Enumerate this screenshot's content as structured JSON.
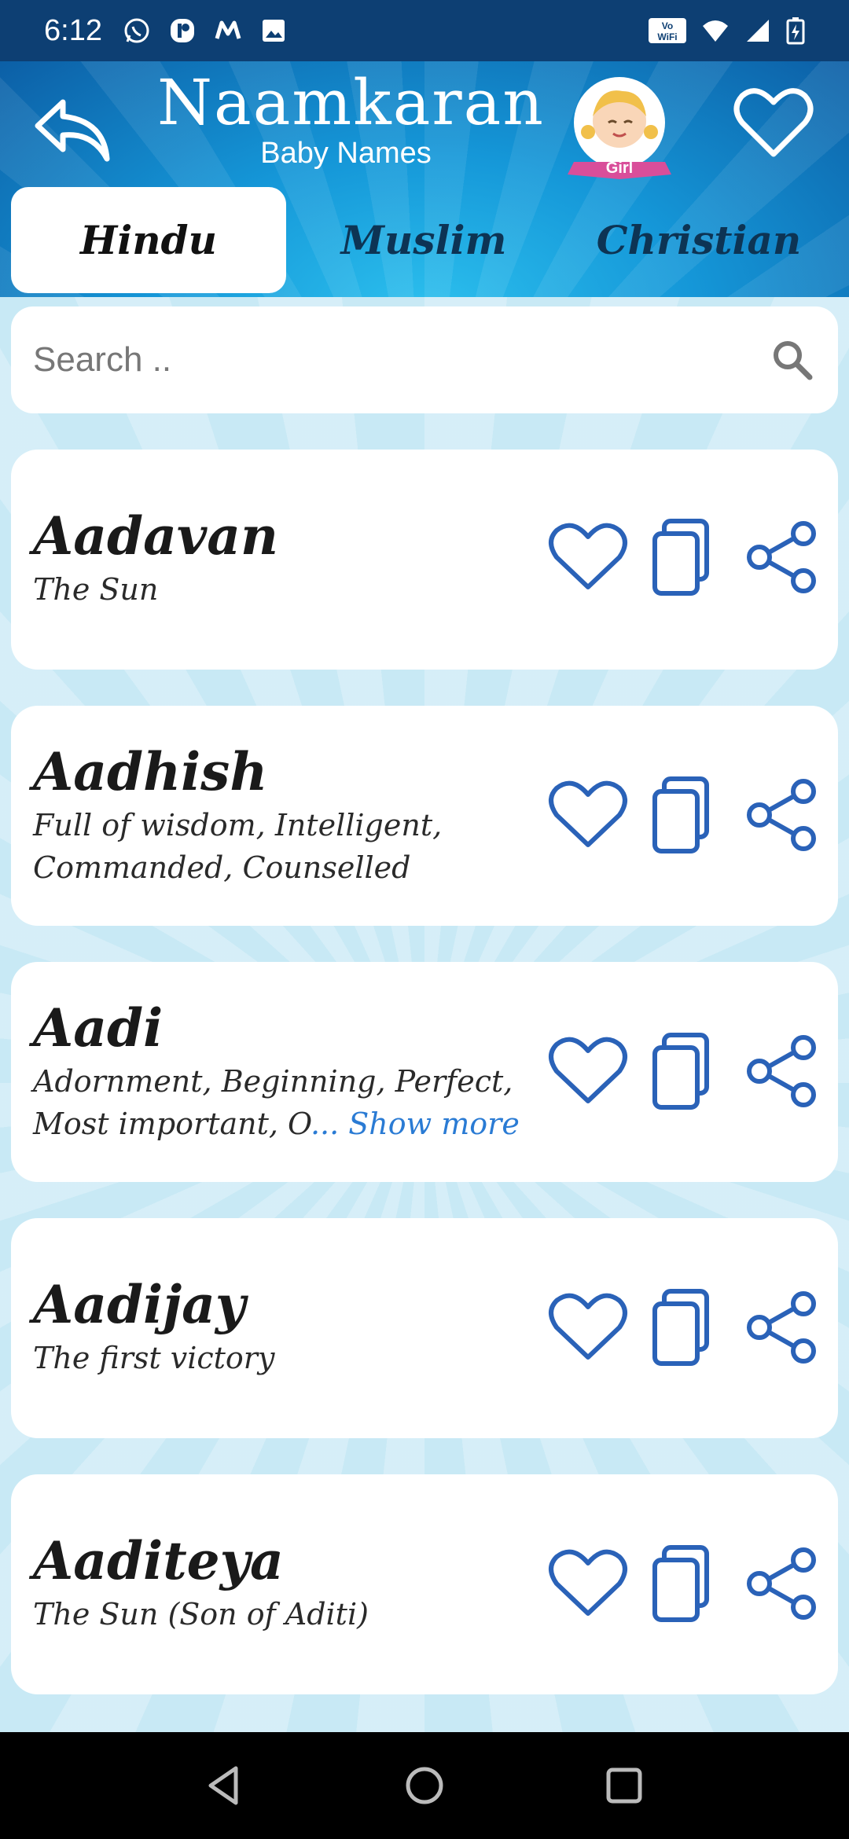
{
  "status_bar": {
    "time": "6:12",
    "icons_left": [
      "whatsapp-icon",
      "app-icon",
      "messages-icon",
      "gallery-icon"
    ],
    "icons_right": [
      "vowifi-icon",
      "wifi-icon",
      "signal-icon",
      "battery-icon"
    ],
    "vowifi_label": "Vo WiFi"
  },
  "header": {
    "title": "Naamkaran",
    "subtitle": "Baby Names",
    "gender_badge": "Girl"
  },
  "tabs": [
    {
      "label": "Hindu",
      "active": true
    },
    {
      "label": "Muslim",
      "active": false
    },
    {
      "label": "Christian",
      "active": false
    }
  ],
  "search": {
    "placeholder": "Search ..",
    "value": ""
  },
  "names": [
    {
      "name": "Aadavan",
      "meaning": "The Sun"
    },
    {
      "name": "Aadhish",
      "meaning_line1": "Full of wisdom, Intelligent,",
      "meaning_line2": "Commanded, Counselled"
    },
    {
      "name": "Aadi",
      "meaning_line1": "Adornment, Beginning, Perfect,",
      "meaning_line2": "Most important, O",
      "show_more": "... Show more"
    },
    {
      "name": "Aadijay",
      "meaning": "The first victory"
    },
    {
      "name": "Aaditeya",
      "meaning": "The Sun (Son of Aditi)"
    }
  ],
  "colors": {
    "accent_blue": "#2a62b8",
    "header_blue": "#1597d8",
    "status_bar": "#0d3f73",
    "link_blue": "#2a7bd4"
  }
}
